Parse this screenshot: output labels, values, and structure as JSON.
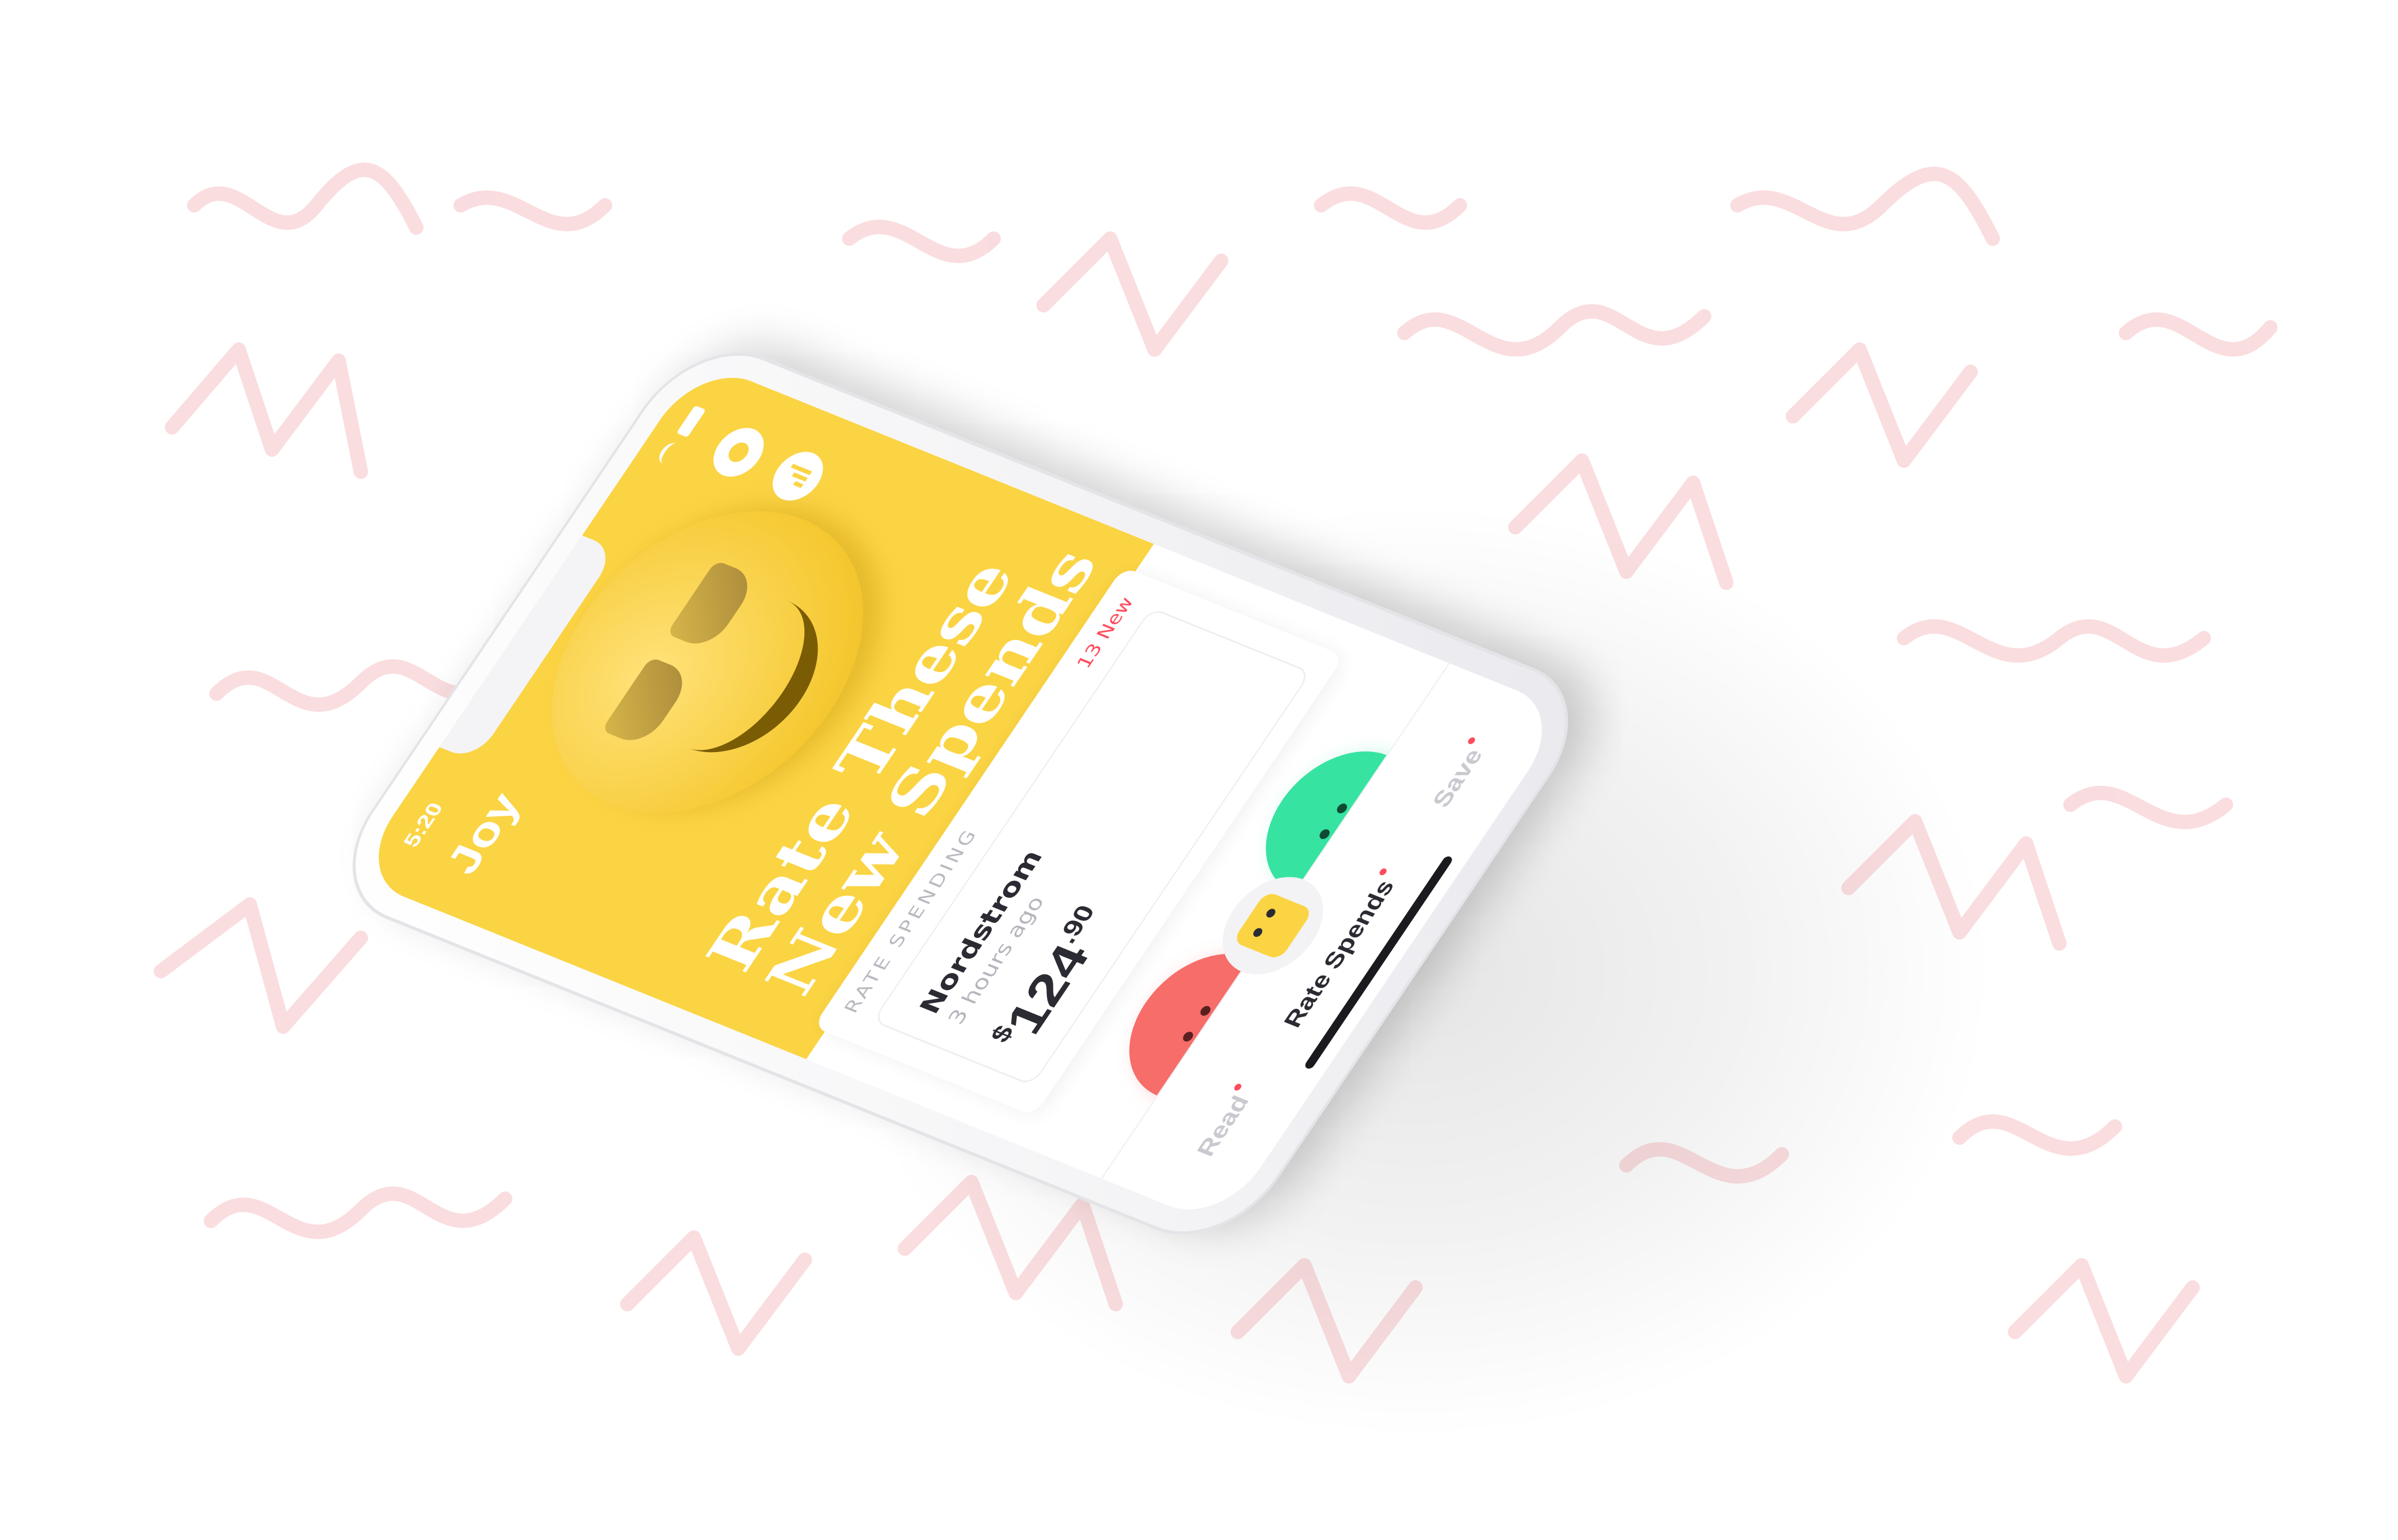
{
  "colors": {
    "brand_yellow": "#fbd444",
    "positive_green": "#36e3a1",
    "negative_red": "#f76d6a",
    "accent_red": "#ff4d5e",
    "scribble_pink": "#f9d9dc",
    "text_dark": "#2b2b33",
    "text_muted": "#b5b5bd"
  },
  "status_bar": {
    "time": "5:20"
  },
  "header": {
    "brand": "Joy",
    "headline_line1": "Rate These",
    "headline_line2": "New Spends"
  },
  "rate_section": {
    "label": "RATE SPENDING",
    "new_count": "13 New",
    "card": {
      "merchant": "Nordstrom",
      "time_ago": "3 hours ago",
      "amount_currency": "$",
      "amount_whole": "124",
      "amount_cents": ".90"
    }
  },
  "actions": {
    "negative_icon": "sad-face-icon",
    "positive_icon": "happy-face-icon"
  },
  "tabs": [
    {
      "label": "Read",
      "has_dot": true
    },
    {
      "label": "Rate Spends",
      "has_dot": true,
      "active": true
    },
    {
      "label": "Save",
      "has_dot": true
    }
  ]
}
